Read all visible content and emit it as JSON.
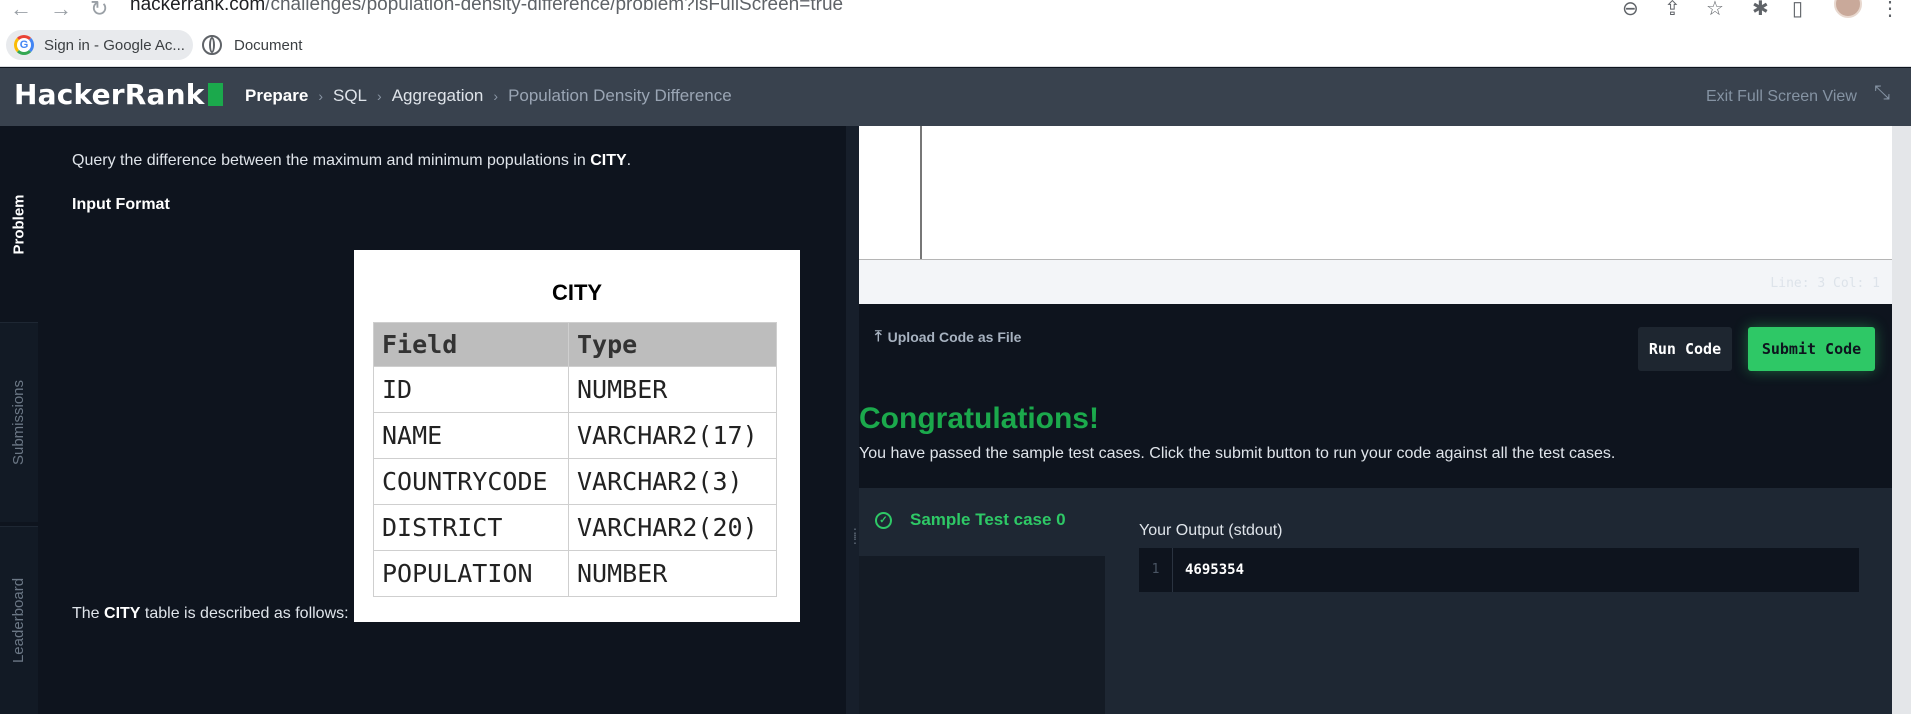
{
  "browser": {
    "url_host": "hackerrank.com",
    "url_path": "/challenges/population-density-difference/problem?isFullScreen=true",
    "bookmarks": [
      {
        "label": "Sign in - Google Ac..."
      },
      {
        "label": "Document"
      }
    ]
  },
  "header": {
    "logo": "HackerRank",
    "breadcrumbs": [
      "Prepare",
      "SQL",
      "Aggregation",
      "Population Density Difference"
    ],
    "exit_label": "Exit Full Screen View"
  },
  "side_tabs": [
    "Problem",
    "Submissions",
    "Leaderboard"
  ],
  "problem": {
    "statement_pre": "Query the difference between the maximum and minimum populations in ",
    "statement_bold": "CITY",
    "statement_post": ".",
    "input_format": "Input Format",
    "desc_pre": "The ",
    "desc_bold": "CITY",
    "desc_post": " table is described as follows:",
    "table": {
      "title": "CITY",
      "headers": [
        "Field",
        "Type"
      ],
      "rows": [
        [
          "ID",
          "NUMBER"
        ],
        [
          "NAME",
          "VARCHAR2(17)"
        ],
        [
          "COUNTRYCODE",
          "VARCHAR2(3)"
        ],
        [
          "DISTRICT",
          "VARCHAR2(20)"
        ],
        [
          "POPULATION",
          "NUMBER"
        ]
      ]
    }
  },
  "editor": {
    "status": "Line: 3 Col: 1"
  },
  "actions": {
    "upload": "Upload Code as File",
    "run": "Run Code",
    "submit": "Submit Code"
  },
  "result": {
    "title": "Congratulations!",
    "message": "You have passed the sample test cases. Click the submit button to run your code against all the test cases.",
    "testcase": "Sample Test case 0",
    "output_label": "Your Output (stdout)",
    "output_line": "1",
    "output_value": "4695354"
  }
}
